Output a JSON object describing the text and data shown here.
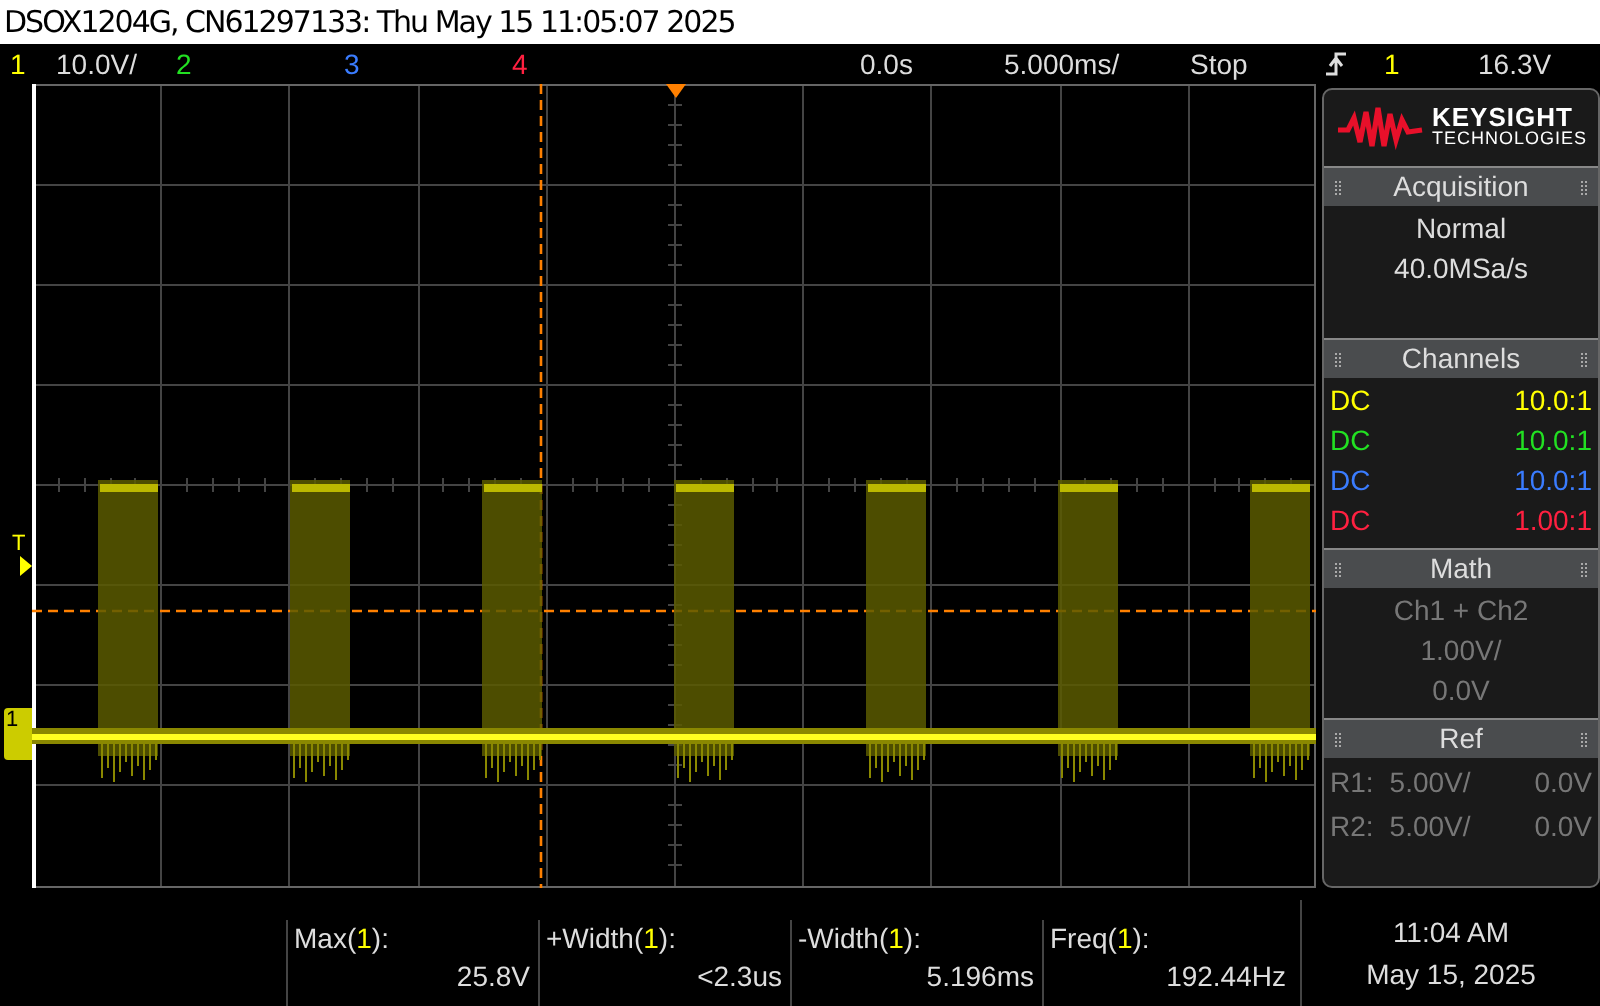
{
  "window": {
    "title": "DSOX1204G, CN61297133: Thu May 15 11:05:07 2025"
  },
  "status_bar": {
    "channels": [
      {
        "label": "1",
        "color": "#ffff00",
        "scale": "10.0V/"
      },
      {
        "label": "2",
        "color": "#22e022"
      },
      {
        "label": "3",
        "color": "#3a7cff"
      },
      {
        "label": "4",
        "color": "#ff2040"
      }
    ],
    "delay": "0.0s",
    "timebase": "5.000ms/",
    "run_state": "Stop",
    "trigger": {
      "source": "1",
      "level": "16.3V"
    }
  },
  "display": {
    "trigger_marker": "T",
    "ground_marker": "1"
  },
  "logo": {
    "name": "KEYSIGHT",
    "subtitle": "TECHNOLOGIES"
  },
  "panels": [
    {
      "kind": "lines",
      "title": "Acquisition",
      "lines": [
        "Normal",
        "40.0MSa/s"
      ],
      "disabled": false
    },
    {
      "kind": "channels",
      "title": "Channels",
      "rows": [
        {
          "coupling": "DC",
          "probe": "10.0:1",
          "color": "#ffff00"
        },
        {
          "coupling": "DC",
          "probe": "10.0:1",
          "color": "#22e022"
        },
        {
          "coupling": "DC",
          "probe": "10.0:1",
          "color": "#3a7cff"
        },
        {
          "coupling": "DC",
          "probe": "1.00:1",
          "color": "#ff2040"
        }
      ]
    },
    {
      "kind": "lines",
      "title": "Math",
      "lines": [
        "Ch1 + Ch2",
        "1.00V/",
        "0.0V"
      ],
      "disabled": true
    },
    {
      "kind": "refs",
      "title": "Ref",
      "rows": [
        {
          "name": "R1:",
          "scale": "5.00V/",
          "offset": "0.0V"
        },
        {
          "name": "R2:",
          "scale": "5.00V/",
          "offset": "0.0V"
        }
      ]
    }
  ],
  "measurements": [
    {
      "label_before": "Max(",
      "channel": "1",
      "label_after": "):",
      "value": "25.8V"
    },
    {
      "label_before": "+Width(",
      "channel": "1",
      "label_after": "):",
      "value": "<2.3us"
    },
    {
      "label_before": "-Width(",
      "channel": "1",
      "label_after": "):",
      "value": "5.196ms"
    },
    {
      "label_before": "Freq(",
      "channel": "1",
      "label_after": "):",
      "value": "192.44Hz"
    }
  ],
  "clock": {
    "time": "11:04 AM",
    "date": "May 15, 2025"
  }
}
